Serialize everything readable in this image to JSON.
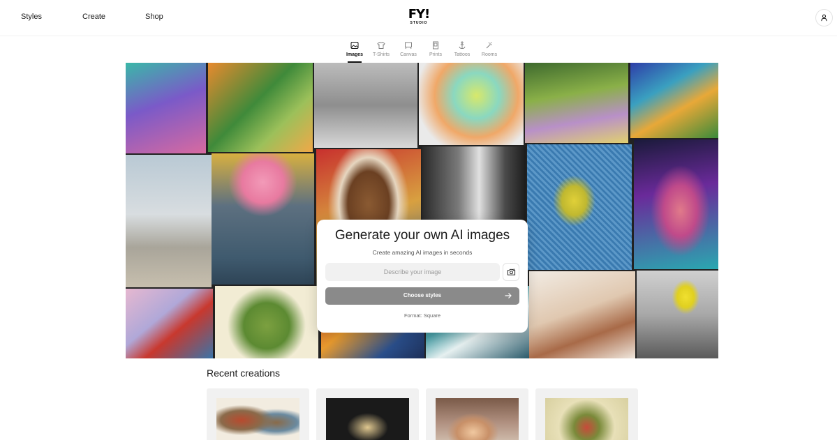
{
  "nav": {
    "links": [
      "Styles",
      "Create",
      "Shop"
    ],
    "logo_mark": "FY!",
    "logo_sub": "STUDIO"
  },
  "tabs": [
    {
      "label": "Images",
      "icon": "image-icon",
      "active": true
    },
    {
      "label": "T-Shirts",
      "icon": "tshirt-icon",
      "active": false
    },
    {
      "label": "Canvas",
      "icon": "canvas-icon",
      "active": false
    },
    {
      "label": "Prints",
      "icon": "print-icon",
      "active": false
    },
    {
      "label": "Tattoos",
      "icon": "anchor-icon",
      "active": false
    },
    {
      "label": "Rooms",
      "icon": "rooms-icon",
      "active": false
    }
  ],
  "generator": {
    "title": "Generate your own AI images",
    "subtitle": "Create amazing AI images in seconds",
    "placeholder": "Describe your image",
    "choose_label": "Choose styles",
    "format_label": "Format: Square"
  },
  "recent": {
    "title": "Recent creations"
  },
  "colors": {
    "button_gray": "#8a8a8a",
    "input_bg": "#f1f1f1",
    "card_bg": "#f1f1f1"
  }
}
